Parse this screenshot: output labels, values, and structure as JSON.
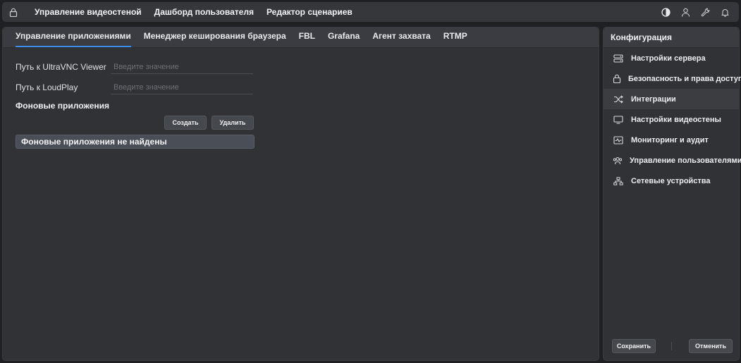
{
  "topbar": {
    "nav": [
      "Управление видеостеной",
      "Дашборд пользователя",
      "Редактор сценариев"
    ],
    "icons": [
      "lock-icon",
      "theme-contrast-icon",
      "user-icon",
      "wrench-icon",
      "bell-icon"
    ]
  },
  "main": {
    "tabs": [
      "Управление приложениями",
      "Менеджер кеширования браузера",
      "FBL",
      "Grafana",
      "Агент захвата",
      "RTMP"
    ],
    "active_tab": 0,
    "fields": [
      {
        "label": "Путь к UltraVNC Viewer",
        "value": "",
        "placeholder": "Введите значение"
      },
      {
        "label": "Путь к LoudPlay",
        "value": "",
        "placeholder": "Введите значение"
      }
    ],
    "section_title": "Фоновые приложения",
    "create_label": "Создать",
    "delete_label": "Удалить",
    "empty_message": "Фоновые приложения не найдены"
  },
  "sidebar": {
    "title": "Конфигурация",
    "items": [
      {
        "label": "Настройки сервера",
        "icon": "server-icon"
      },
      {
        "label": "Безопасность и права доступа",
        "icon": "lock-icon"
      },
      {
        "label": "Интеграции",
        "icon": "shuffle-icon"
      },
      {
        "label": "Настройки видеостены",
        "icon": "monitor-icon"
      },
      {
        "label": "Мониторинг и аудит",
        "icon": "activity-icon"
      },
      {
        "label": "Управление пользователями",
        "icon": "users-icon"
      },
      {
        "label": "Сетевые устройства",
        "icon": "network-icon"
      }
    ],
    "save_label": "Сохранить",
    "cancel_label": "Отменить"
  },
  "colors": {
    "accent": "#3d8ff0",
    "background": "#1f2022",
    "panel": "#303236"
  }
}
